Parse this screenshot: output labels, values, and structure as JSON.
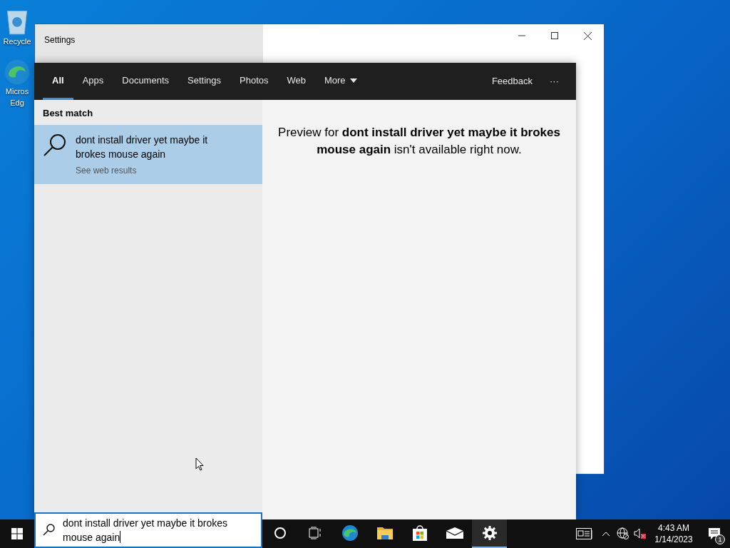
{
  "desktop_icons": [
    {
      "kind": "recycle",
      "lines": [
        "Recycle"
      ]
    },
    {
      "kind": "edge",
      "lines": [
        "Micros",
        "Edg"
      ]
    }
  ],
  "settings_window": {
    "title": "Settings"
  },
  "search": {
    "tabs": [
      {
        "label": "All",
        "selected": true
      },
      {
        "label": "Apps",
        "selected": false
      },
      {
        "label": "Documents",
        "selected": false
      },
      {
        "label": "Settings",
        "selected": false
      },
      {
        "label": "Photos",
        "selected": false
      },
      {
        "label": "Web",
        "selected": false
      },
      {
        "label": "More",
        "selected": false,
        "dropdown": true
      }
    ],
    "feedback": "Feedback",
    "more_options": "···",
    "section_title": "Best match",
    "best_match": {
      "title": "dont install driver yet maybe it brokes mouse again",
      "subtitle": "See web results",
      "selected": true
    },
    "preview": "Preview for **dont install driver yet maybe it brokes mouse again** isn't available right now.",
    "query": "dont install driver yet maybe it brokes mouse again"
  },
  "taskbar": {
    "apps": [
      {
        "kind": "cortana",
        "active": false
      },
      {
        "kind": "taskview",
        "active": false
      },
      {
        "kind": "edge",
        "active": false
      },
      {
        "kind": "explorer",
        "active": false
      },
      {
        "kind": "store",
        "active": false
      },
      {
        "kind": "mail",
        "active": false
      },
      {
        "kind": "settings",
        "active": true
      }
    ],
    "time": "4:43 AM",
    "date": "1/14/2023",
    "notification_count": "1"
  }
}
